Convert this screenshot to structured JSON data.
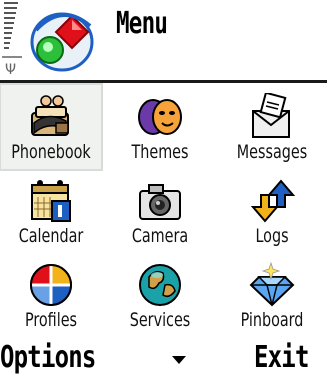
{
  "header": {
    "title": "Menu",
    "app_icon": "menu-app-icon",
    "signal_icon": "signal-strength-icon",
    "signal_glyph": "Ψ"
  },
  "grid": {
    "selected_index": 0,
    "items": [
      {
        "label": "Phonebook",
        "icon": "phonebook-icon"
      },
      {
        "label": "Themes",
        "icon": "themes-icon"
      },
      {
        "label": "Messages",
        "icon": "messages-icon"
      },
      {
        "label": "Calendar",
        "icon": "calendar-icon"
      },
      {
        "label": "Camera",
        "icon": "camera-icon"
      },
      {
        "label": "Logs",
        "icon": "logs-icon"
      },
      {
        "label": "Profiles",
        "icon": "profiles-icon"
      },
      {
        "label": "Services",
        "icon": "services-icon"
      },
      {
        "label": "Pinboard",
        "icon": "pinboard-icon"
      }
    ]
  },
  "softkeys": {
    "left": "Options",
    "right": "Exit",
    "center_icon": "arrow-down-icon"
  },
  "colors": {
    "accent_red": "#e0101a",
    "accent_blue": "#1d5fc2",
    "selection_bg": "#f0f2f0"
  }
}
